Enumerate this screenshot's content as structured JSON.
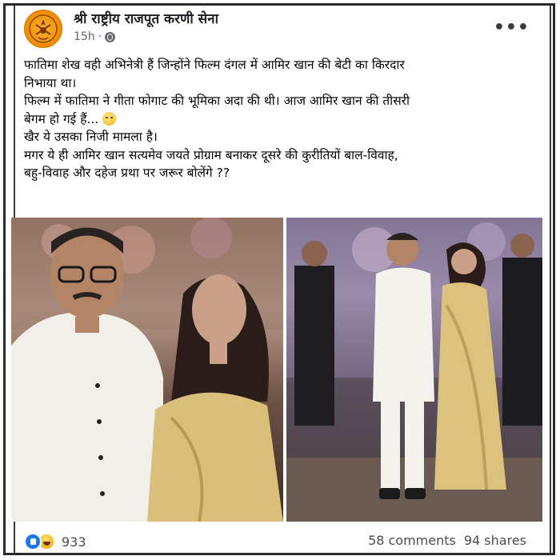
{
  "post": {
    "page_name": "श्री राष्ट्रीय राजपूत करणी सेना",
    "time": "15h",
    "separator": "·",
    "more_icon": "more-options-icon",
    "privacy_icon": "globe-icon",
    "lines": [
      "फातिमा शेख वही अभिनेत्री हैं जिन्होंने फिल्म दंगल में आमिर खान की बेटी का किरदार",
      "निभाया था।",
      "फिल्म में फातिमा ने गीता फोगाट की भूमिका अदा की थी। आज आमिर खान की तीसरी",
      "बेगम हो गई हैं...",
      "खैर ये उसका निजी मामला है।",
      "मगर ये ही आमिर खान सत्यमेव जयते प्रोग्राम बनाकर दूसरे की कुरीतियों बाल-विवाह,",
      "बहु-विवाह और दहेज प्रथा पर जरूर बोलेंगे ??"
    ]
  },
  "footer": {
    "reaction_count": "933",
    "comments": "58 comments",
    "shares": "94 shares"
  },
  "colors": {
    "facebook_blue": "#1877f2",
    "text_primary": "#050505",
    "text_secondary": "#65676b",
    "avatar_orange": "#f08a00"
  }
}
